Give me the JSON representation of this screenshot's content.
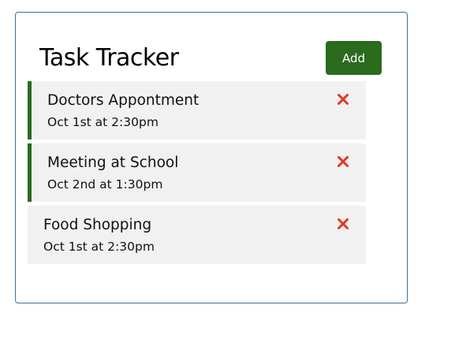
{
  "header": {
    "title": "Task Tracker",
    "add_label": "Add"
  },
  "tasks": [
    {
      "name": "Doctors Appontment",
      "date": "Oct 1st at 2:30pm",
      "reminder": true
    },
    {
      "name": "Meeting at School",
      "date": "Oct 2nd at 1:30pm",
      "reminder": true
    },
    {
      "name": "Food Shopping",
      "date": "Oct 1st at 2:30pm",
      "reminder": false
    }
  ],
  "colors": {
    "accent": "#2a6b1e",
    "delete": "#e53522",
    "task_bg": "#f1f1f1",
    "border": "#3f6f9a"
  },
  "icons": {
    "delete": "close-icon"
  }
}
